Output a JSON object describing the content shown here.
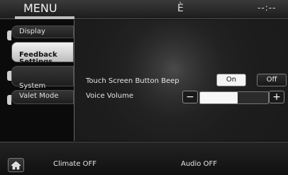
{
  "header": {
    "title": "MENU",
    "status_icon": "È",
    "clock": "--:--"
  },
  "sidebar": {
    "items": [
      {
        "label": "Display",
        "active": false
      },
      {
        "label": "Feedback\nSettings",
        "active": true
      },
      {
        "label": "System\nSettings",
        "active": false
      },
      {
        "label": "Valet Mode",
        "active": false
      }
    ]
  },
  "settings": {
    "beep_label": "Touch Screen Button Beep",
    "beep_on": "On",
    "beep_off": "Off",
    "beep_selected": "On",
    "volume_label": "Voice Volume",
    "volume_minus": "−",
    "volume_plus": "+",
    "volume_level": 0.55
  },
  "bottom": {
    "home_icon": "home-icon",
    "climate_label": "Climate OFF",
    "audio_label": "Audio OFF"
  },
  "colors": {
    "background": "#0a0a0a",
    "active_tab": "#e0e0e0",
    "selected_button": "#f4f4f4"
  }
}
